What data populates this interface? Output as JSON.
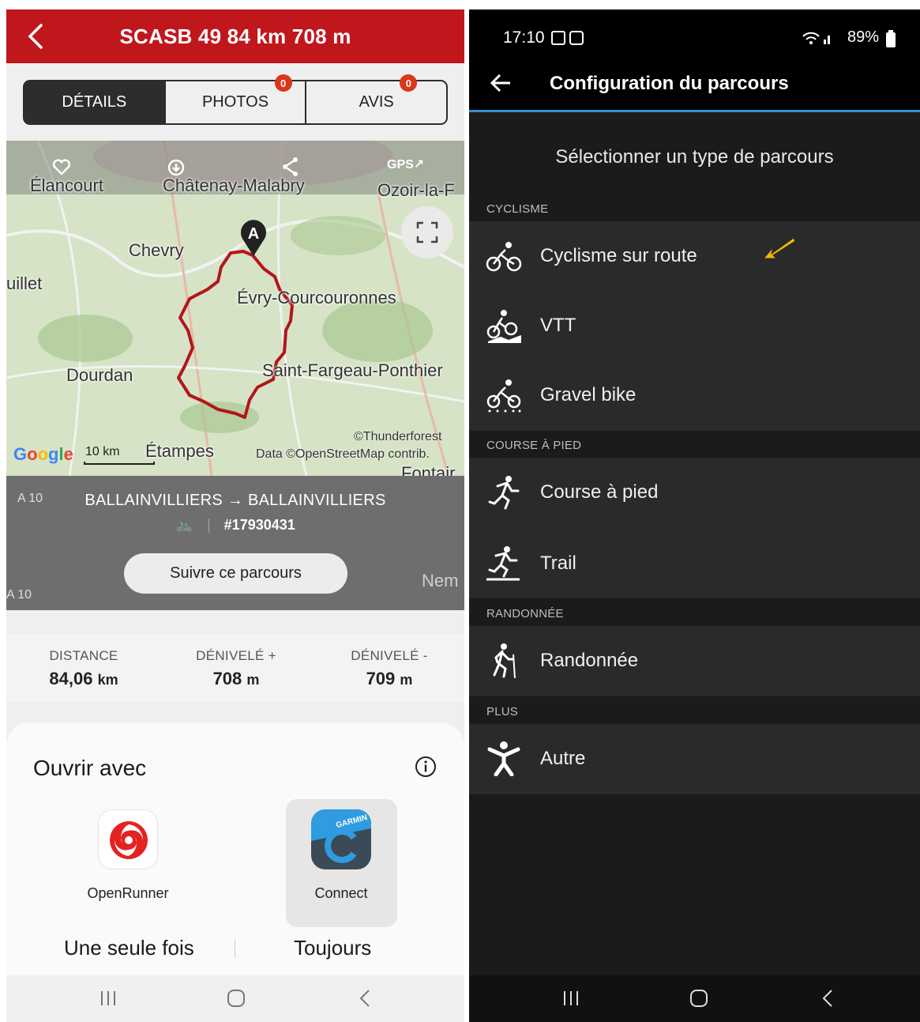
{
  "left": {
    "header": {
      "title": "SCASB 49 84 km 708 m"
    },
    "tabs": [
      {
        "label": "DÉTAILS",
        "badge": null
      },
      {
        "label": "PHOTOS",
        "badge": "0"
      },
      {
        "label": "AVIS",
        "badge": "0"
      }
    ],
    "map": {
      "tools": [
        "GPS"
      ],
      "places": [
        "Élancourt",
        "Châtenay-Malabry",
        "Ozoir-la-F",
        "Chevry",
        "uillet",
        "Évry-Courcouronnes",
        "Dourdan",
        "Saint-Fargeau-Ponthier",
        "Étampes",
        "Fontair",
        "Nem",
        "A 10",
        "A 10"
      ],
      "marker": "A",
      "attribution1": "©Thunderforest",
      "attribution2": "Data ©OpenStreetMap contrib.",
      "google": "Google",
      "scale": "10 km"
    },
    "route": {
      "names": "BALLAINVILLIERS → BALLAINVILLIERS",
      "id": "#17930431",
      "follow": "Suivre ce parcours"
    },
    "stats": [
      {
        "label": "DISTANCE",
        "value": "84,06",
        "unit": "km"
      },
      {
        "label": "DÉNIVELÉ +",
        "value": "708",
        "unit": "m"
      },
      {
        "label": "DÉNIVELÉ -",
        "value": "709",
        "unit": "m"
      }
    ],
    "sheet": {
      "title": "Ouvrir avec",
      "apps": [
        {
          "name": "OpenRunner"
        },
        {
          "name": "Connect",
          "logo_text": "GARMIN"
        }
      ],
      "once": "Une seule fois",
      "always": "Toujours"
    }
  },
  "right": {
    "status": {
      "time": "17:10",
      "battery": "89%"
    },
    "header": {
      "title": "Configuration du parcours"
    },
    "subtitle": "Sélectionner un type de parcours",
    "sections": [
      {
        "label": "CYCLISME",
        "items": [
          {
            "label": "Cyclisme sur route",
            "icon": "road-bike-icon"
          },
          {
            "label": "VTT",
            "icon": "mountain-bike-icon"
          },
          {
            "label": "Gravel bike",
            "icon": "gravel-bike-icon"
          }
        ]
      },
      {
        "label": "COURSE À PIED",
        "items": [
          {
            "label": "Course à pied",
            "icon": "running-icon"
          },
          {
            "label": "Trail",
            "icon": "trail-running-icon"
          }
        ]
      },
      {
        "label": "RANDONNÉE",
        "items": [
          {
            "label": "Randonnée",
            "icon": "hiking-icon"
          }
        ]
      },
      {
        "label": "PLUS",
        "items": [
          {
            "label": "Autre",
            "icon": "other-activity-icon"
          }
        ]
      }
    ]
  },
  "colors": {
    "brand_red": "#c0171d",
    "badge": "#d9371a",
    "route": "#b3151b",
    "accent_blue": "#2c8fd6",
    "arrow": "#f4b400"
  }
}
